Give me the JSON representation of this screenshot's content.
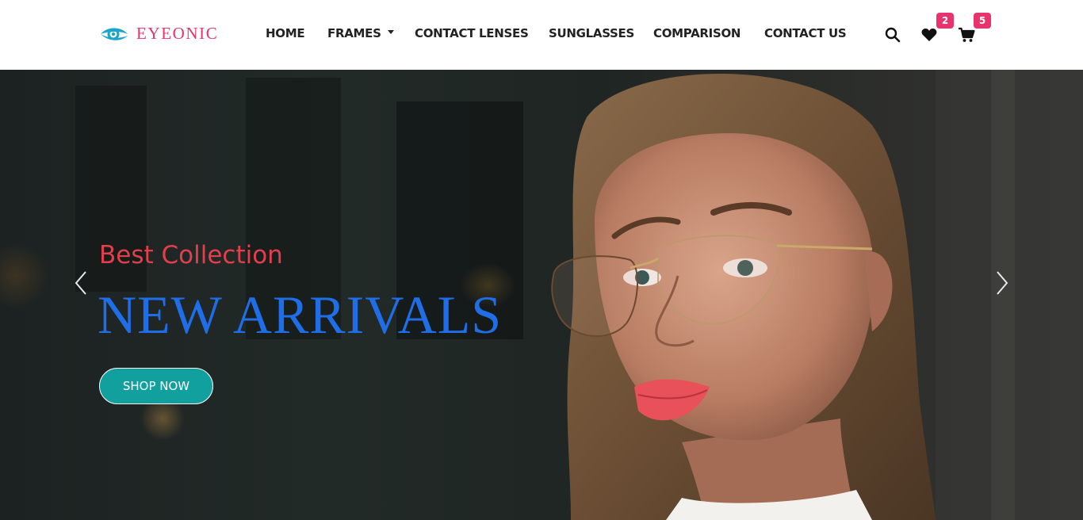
{
  "brand": {
    "name": "EYEONIC",
    "logo_icon": "eye-logo-icon",
    "accent_color": "#e8336d",
    "logo_color": "#1aa6c8"
  },
  "nav": {
    "items": [
      {
        "label": "HOME"
      },
      {
        "label": "FRAMES",
        "dropdown": true
      },
      {
        "label": "CONTACT LENSES"
      },
      {
        "label": "SUNGLASSES"
      },
      {
        "label": "COMPARISON"
      },
      {
        "label": "CONTACT US"
      }
    ]
  },
  "actions": {
    "search_icon": "search-icon",
    "wishlist": {
      "icon": "heart-icon",
      "count": "2"
    },
    "cart": {
      "icon": "cart-icon",
      "count": "5"
    }
  },
  "hero": {
    "subtitle": "Best Collection",
    "title": "NEW ARRIVALS",
    "cta_label": "SHOP NOW",
    "image_description_icon": "model-with-glasses",
    "subtitle_color": "#e23f4c",
    "title_color": "#1f6ee8",
    "cta_color": "#12a09e"
  },
  "carousel": {
    "prev_icon": "chevron-left-icon",
    "next_icon": "chevron-right-icon"
  }
}
